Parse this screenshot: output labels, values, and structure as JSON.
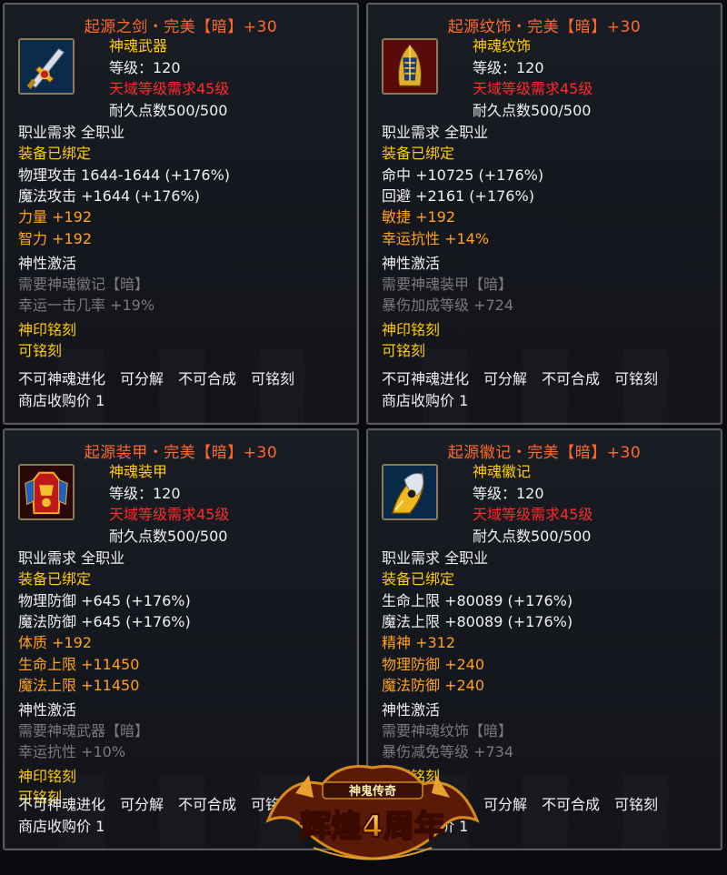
{
  "cards": [
    {
      "title": "起源之剑・完美【暗】+30",
      "icon": "sword-icon",
      "type": "神魂武器",
      "level": "等级：120",
      "req": "天域等级需求45级",
      "durability": "耐久点数500/500",
      "job": "职业需求 全职业",
      "bound": "装备已绑定",
      "stats": [
        {
          "text": "物理攻击 1644-1644 (+176%)",
          "color": "white"
        },
        {
          "text": "魔法攻击 +1644 (+176%)",
          "color": "white"
        },
        {
          "text": "力量 +192",
          "color": "orange"
        },
        {
          "text": "智力 +192",
          "color": "orange"
        }
      ],
      "divine_title": "神性激活",
      "divine_req": "需要神魂徽记【暗】",
      "divine_bonus": "幸运一击几率 +19%",
      "engrave_title": "神印铭刻",
      "engrave_state": "可铭刻",
      "flags": "不可神魂进化　可分解　不可合成　可铭刻",
      "price": "商店收购价 1"
    },
    {
      "title": "起源纹饰・完美【暗】+30",
      "icon": "helmet-icon",
      "type": "神魂纹饰",
      "level": "等级：120",
      "req": "天域等级需求45级",
      "durability": "耐久点数500/500",
      "job": "职业需求 全职业",
      "bound": "装备已绑定",
      "stats": [
        {
          "text": "命中 +10725 (+176%)",
          "color": "white"
        },
        {
          "text": "回避 +2161 (+176%)",
          "color": "white"
        },
        {
          "text": "敏捷 +192",
          "color": "orange"
        },
        {
          "text": "幸运抗性 +14%",
          "color": "orange"
        }
      ],
      "divine_title": "神性激活",
      "divine_req": "需要神魂装甲【暗】",
      "divine_bonus": "暴伤加成等级 +724",
      "engrave_title": "神印铭刻",
      "engrave_state": "可铭刻",
      "flags": "不可神魂进化　可分解　不可合成　可铭刻",
      "price": "商店收购价 1"
    },
    {
      "title": "起源装甲・完美【暗】+30",
      "icon": "armor-icon",
      "type": "神魂装甲",
      "level": "等级：120",
      "req": "天域等级需求45级",
      "durability": "耐久点数500/500",
      "job": "职业需求 全职业",
      "bound": "装备已绑定",
      "stats": [
        {
          "text": "物理防御 +645 (+176%)",
          "color": "white"
        },
        {
          "text": "魔法防御 +645 (+176%)",
          "color": "white"
        },
        {
          "text": "体质 +192",
          "color": "orange"
        },
        {
          "text": "生命上限 +11450",
          "color": "orange"
        },
        {
          "text": "魔法上限 +11450",
          "color": "orange"
        }
      ],
      "divine_title": "神性激活",
      "divine_req": "需要神魂武器【暗】",
      "divine_bonus": "幸运抗性 +10%",
      "engrave_title": "神印铭刻",
      "engrave_state": "可铭刻",
      "flags": "不可神魂进化　可分解　不可合成　可铭刻",
      "price": "商店收购价 1"
    },
    {
      "title": "起源徽记・完美【暗】+30",
      "icon": "emblem-icon",
      "type": "神魂徽记",
      "level": "等级：120",
      "req": "天域等级需求45级",
      "durability": "耐久点数500/500",
      "job": "职业需求 全职业",
      "bound": "装备已绑定",
      "stats": [
        {
          "text": "生命上限 +80089 (+176%)",
          "color": "white"
        },
        {
          "text": "魔法上限 +80089 (+176%)",
          "color": "white"
        },
        {
          "text": "精神 +312",
          "color": "orange"
        },
        {
          "text": "物理防御 +240",
          "color": "orange"
        },
        {
          "text": "魔法防御 +240",
          "color": "orange"
        }
      ],
      "divine_title": "神性激活",
      "divine_req": "需要神魂纹饰【暗】",
      "divine_bonus": "暴伤减免等级 +734",
      "engrave_title": "神印铭刻",
      "engrave_state": "可铭刻",
      "flags": "不可神魂进化　可分解　不可合成　可铭刻",
      "price": "商店收购价 1"
    }
  ],
  "logo": {
    "text": "辉煌4周年",
    "subtitle": "神鬼传奇"
  },
  "colors": {
    "title": "#ff6a2a",
    "gold": "#ffcc00",
    "orange": "#ffa21a",
    "red": "#ff2a2a",
    "gray": "#7a7a7a",
    "white": "#f0f0f0"
  }
}
